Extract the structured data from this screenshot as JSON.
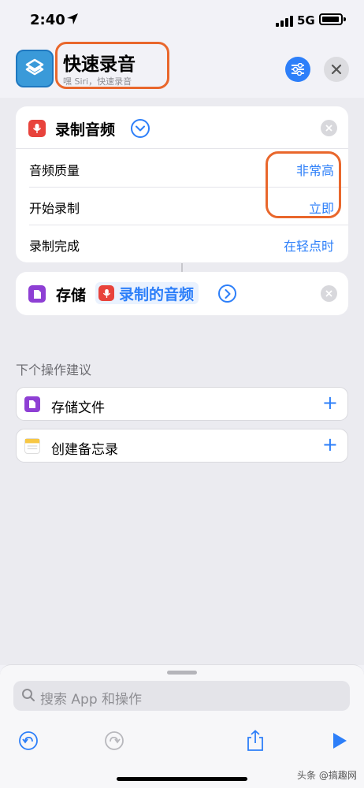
{
  "status": {
    "time": "2:40",
    "network": "5G"
  },
  "header": {
    "title": "快速录音",
    "subtitle": "嘿 Siri，快速录音",
    "accent": "#2d7ff9",
    "highlight": "#e9672c"
  },
  "action_record": {
    "title": "录制音频",
    "params": [
      {
        "label": "音频质量",
        "value": "非常高"
      },
      {
        "label": "开始录制",
        "value": "立即"
      },
      {
        "label": "录制完成",
        "value": "在轻点时"
      }
    ]
  },
  "action_save": {
    "verb": "存储",
    "variable": "录制的音频"
  },
  "suggestions": {
    "title": "下个操作建议",
    "items": [
      {
        "label": "存储文件",
        "icon": "document-icon"
      },
      {
        "label": "创建备忘录",
        "icon": "notes-icon"
      }
    ]
  },
  "bottom": {
    "search_placeholder": "搜索 App 和操作"
  },
  "watermark": "头条 @搞趣网"
}
